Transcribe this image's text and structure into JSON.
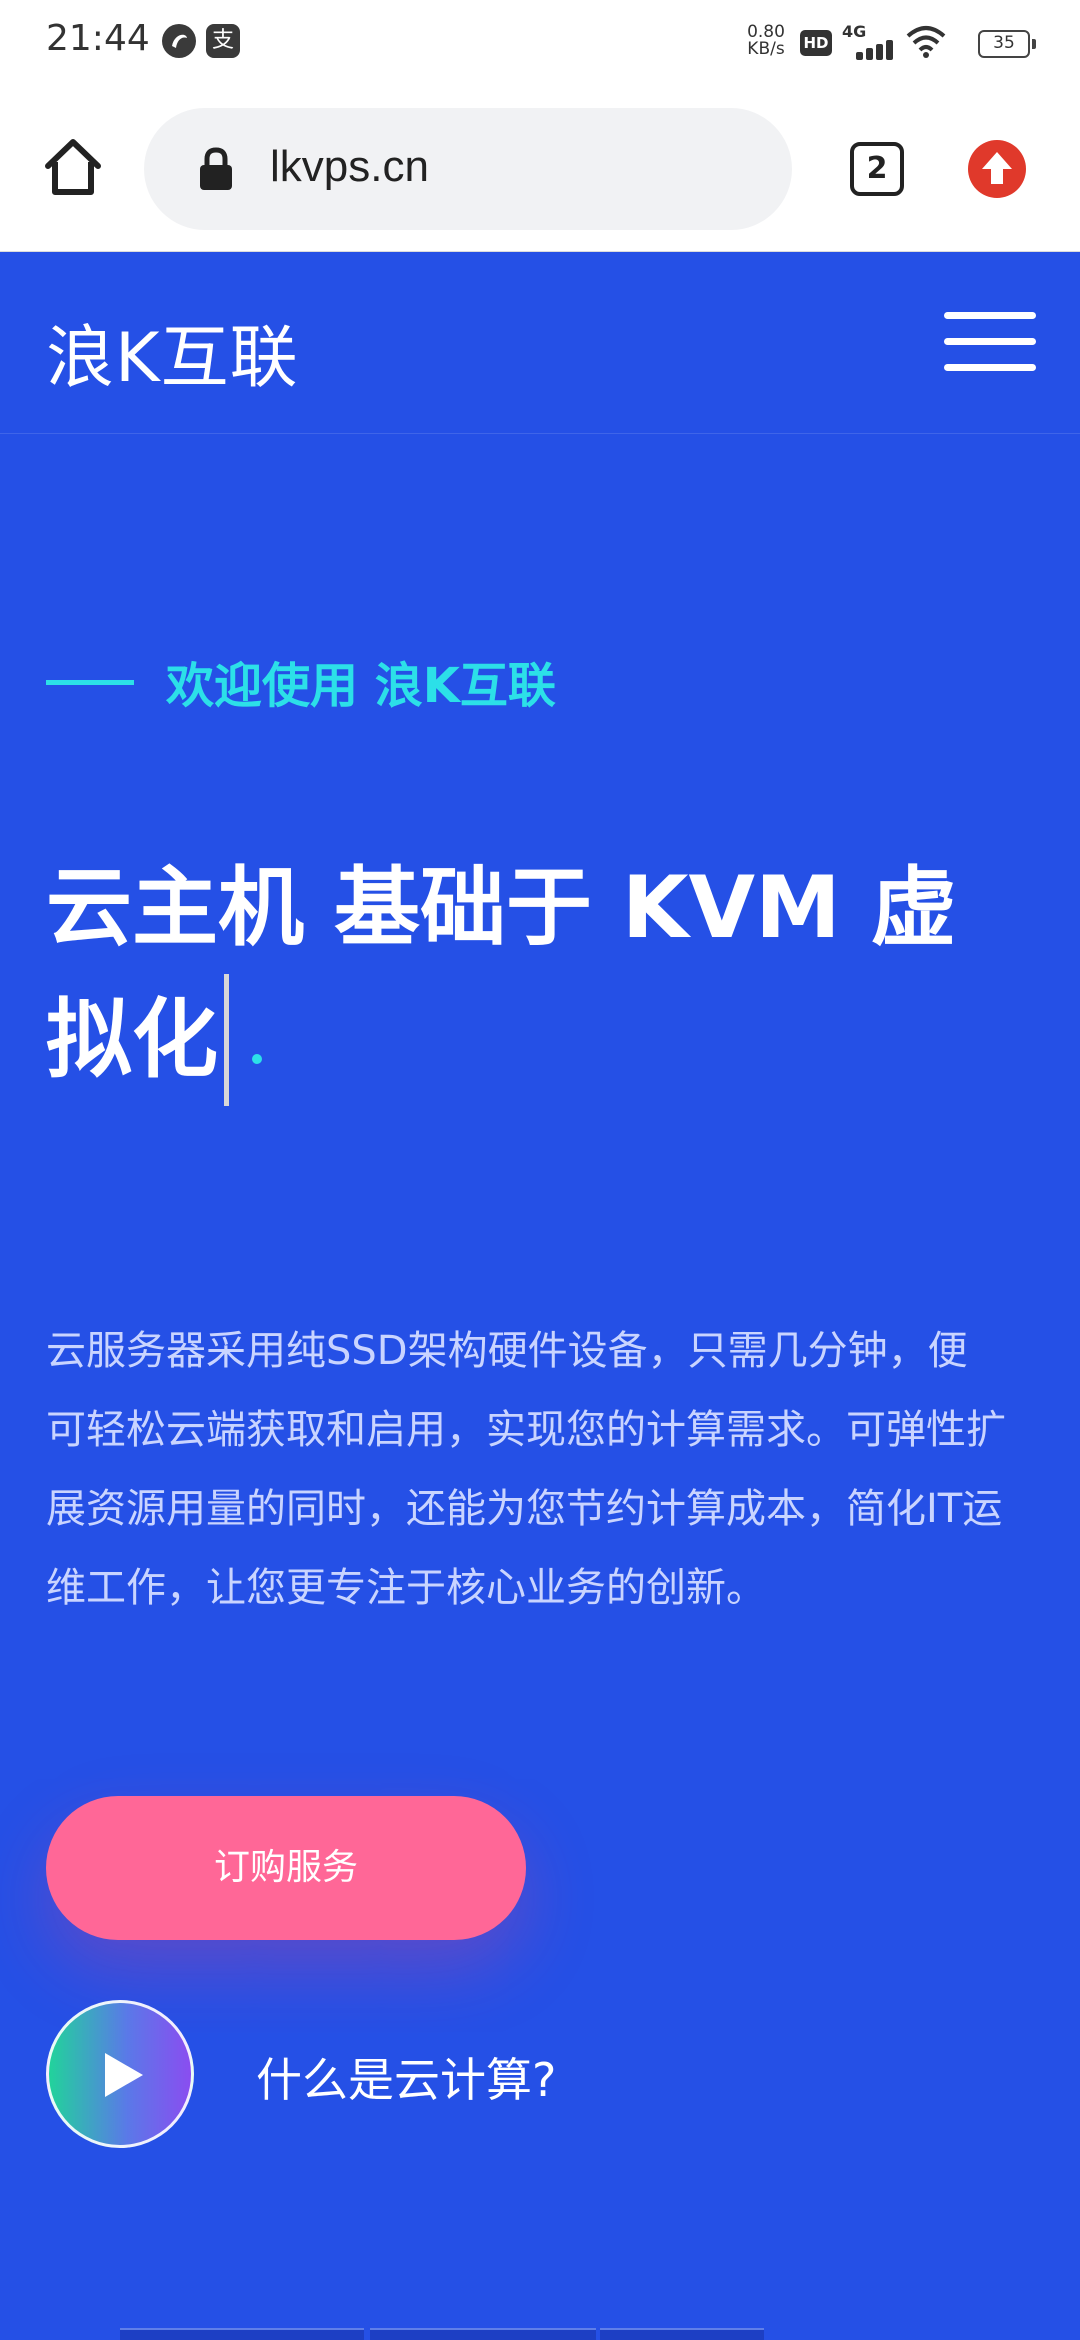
{
  "status_bar": {
    "time": "21:44",
    "left_icons": [
      "browser-logo-icon",
      "alipay-icon"
    ],
    "alipay_glyph": "支",
    "net_speed_value": "0.80",
    "net_speed_unit": "KB/s",
    "hd_label": "HD",
    "signal_label": "4G",
    "battery": "35"
  },
  "browser": {
    "url": "lkvps.cn",
    "tab_count": "2"
  },
  "site": {
    "brand": "浪K互联",
    "accent_color": "#2ce0e8",
    "background_color": "#2550e6"
  },
  "hero": {
    "welcome": "欢迎使用 浪K互联",
    "headline": "云主机 基础于 KVM 虚拟化",
    "description": "云服务器采用纯SSD架构硬件设备，只需几分钟，便可轻松云端获取和启用，实现您的计算需求。可弹性扩展资源用量的同时，还能为您节约计算成本，简化IT运维工作，让您更专注于核心业务的创新。",
    "order_button": "订购服务",
    "video_label": "什么是云计算?"
  }
}
